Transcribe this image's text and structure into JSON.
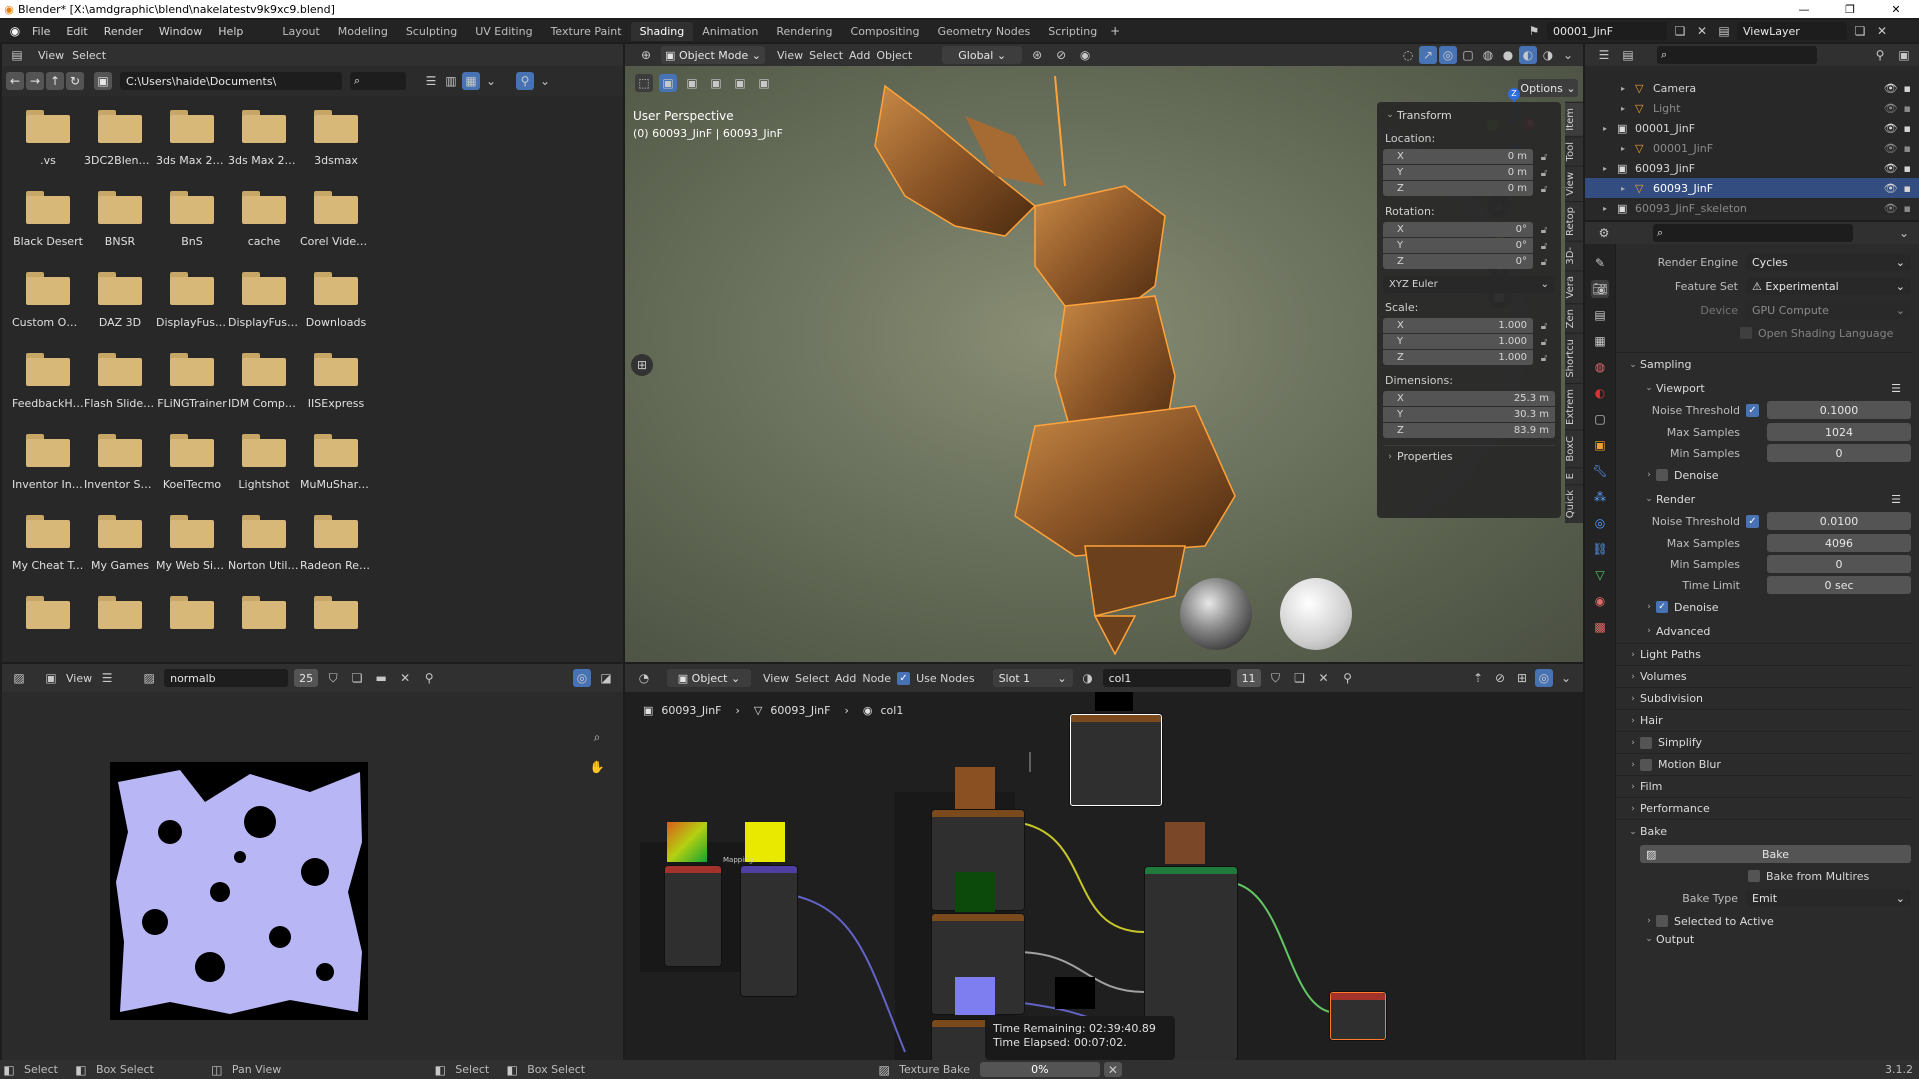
{
  "window": {
    "title": "Blender* [X:\\amdgraphic\\blend\\nakelatestv9k9xc9.blend]"
  },
  "menu": [
    "File",
    "Edit",
    "Render",
    "Window",
    "Help"
  ],
  "workspaces": [
    "Layout",
    "Modeling",
    "Sculpting",
    "UV Editing",
    "Texture Paint",
    "Shading",
    "Animation",
    "Rendering",
    "Compositing",
    "Geometry Nodes",
    "Scripting"
  ],
  "active_workspace": "Shading",
  "scene": "00001_JinF",
  "view_layer": "ViewLayer",
  "file_browser": {
    "menu": [
      "View",
      "Select"
    ],
    "path": "C:\\Users\\haide\\Documents\\",
    "folders": [
      ".vs",
      "3DC2Blender",
      "3ds Max 2020",
      "3ds Max 2023",
      "3dsmax",
      "Black Desert",
      "BNSR",
      "BnS",
      "cache",
      "Corel VideoSt...",
      "Custom Offic...",
      "DAZ 3D",
      "DisplayFusion...",
      "DisplayFusion...",
      "Downloads",
      "FeedbackHub",
      "Flash Slidesh...",
      "FLiNGTrainer",
      "IDM Compute...",
      "IISExpress",
      "Inventor Inter...",
      "Inventor Serv...",
      "KoeiTecmo",
      "Lightshot",
      "MuMuShared...",
      "My Cheat Tab...",
      "My Games",
      "My Web Sites",
      "Norton Utiliti...",
      "Radeon ReLive",
      "",
      "",
      "",
      "",
      "",
      ""
    ]
  },
  "viewport": {
    "mode": "Object Mode",
    "menu": [
      "View",
      "Select",
      "Add",
      "Object"
    ],
    "orientation": "Global",
    "options": "Options",
    "perspective": "User Perspective",
    "object_info": "(0) 60093_JinF | 60093_JinF",
    "transform": {
      "title": "Transform",
      "location_label": "Location:",
      "location": [
        [
          "X",
          "0 m"
        ],
        [
          "Y",
          "0 m"
        ],
        [
          "Z",
          "0 m"
        ]
      ],
      "rotation_label": "Rotation:",
      "rotation": [
        [
          "X",
          "0°"
        ],
        [
          "Y",
          "0°"
        ],
        [
          "Z",
          "0°"
        ]
      ],
      "rotation_mode": "XYZ Euler",
      "scale_label": "Scale:",
      "scale": [
        [
          "X",
          "1.000"
        ],
        [
          "Y",
          "1.000"
        ],
        [
          "Z",
          "1.000"
        ]
      ],
      "dimensions_label": "Dimensions:",
      "dimensions": [
        [
          "X",
          "25.3 m"
        ],
        [
          "Y",
          "30.3 m"
        ],
        [
          "Z",
          "83.9 m"
        ]
      ],
      "properties": "Properties"
    },
    "side_tabs": [
      "Item",
      "Tool",
      "View",
      "Retop",
      "3D-",
      "Vera",
      "Zen",
      "Shortcu",
      "Extrem",
      "BoxC",
      "E",
      "Quick"
    ]
  },
  "image_editor": {
    "menu": "View",
    "image": "normalb",
    "users": "25"
  },
  "node_editor": {
    "object": "Object",
    "menu": [
      "View",
      "Select",
      "Add",
      "Node"
    ],
    "use_nodes": "Use Nodes",
    "slot": "Slot 1",
    "material": "col1",
    "users": "11",
    "breadcrumb": [
      "60093_JinF",
      "60093_JinF",
      "col1"
    ],
    "mapping_label": "Mapping",
    "time_remaining": "Time Remaining: 02:39:40.89",
    "time_elapsed": "Time Elapsed: 00:07:02."
  },
  "outliner": {
    "items": [
      {
        "name": "Camera",
        "indent": 2,
        "dim": false,
        "selected": false
      },
      {
        "name": "Light",
        "indent": 2,
        "dim": true,
        "selected": false
      },
      {
        "name": "00001_JinF",
        "indent": 1,
        "dim": false,
        "selected": false
      },
      {
        "name": "00001_JinF",
        "indent": 2,
        "dim": true,
        "selected": false
      },
      {
        "name": "60093_JinF",
        "indent": 1,
        "dim": false,
        "selected": false
      },
      {
        "name": "60093_JinF",
        "indent": 2,
        "dim": false,
        "selected": true
      },
      {
        "name": "60093_JinF_skeleton",
        "indent": 1,
        "dim": true,
        "selected": false
      }
    ]
  },
  "properties": {
    "render_engine_label": "Render Engine",
    "render_engine": "Cycles",
    "feature_set_label": "Feature Set",
    "feature_set": "Experimental",
    "device_label": "Device",
    "device": "GPU Compute",
    "osl": "Open Shading Language",
    "sampling": "Sampling",
    "viewport": "Viewport",
    "noise_threshold": "Noise Threshold",
    "vp_noise": "0.1000",
    "max_samples": "Max Samples",
    "vp_max": "1024",
    "min_samples": "Min Samples",
    "vp_min": "0",
    "denoise": "Denoise",
    "render": "Render",
    "r_noise": "0.0100",
    "r_max": "4096",
    "r_min": "0",
    "time_limit": "Time Limit",
    "r_time": "0 sec",
    "advanced": "Advanced",
    "panels": [
      "Light Paths",
      "Volumes",
      "Subdivision",
      "Hair",
      "Simplify",
      "Motion Blur",
      "Film",
      "Performance"
    ],
    "bake": "Bake",
    "bake_button": "Bake",
    "bake_multires": "Bake from Multires",
    "bake_type_label": "Bake Type",
    "bake_type": "Emit",
    "selected_to_active": "Selected to Active",
    "output": "Output"
  },
  "status": {
    "items": [
      "Select",
      "Box Select",
      "Pan View",
      "Select",
      "Box Select"
    ],
    "job": "Texture Bake",
    "progress": "0%",
    "progress_value": 0,
    "version": "3.1.2"
  },
  "colors": {
    "accent": "#4772b3",
    "header": "#303030",
    "panel": "#282828",
    "selected": "#334d80",
    "folder": "#d8b878",
    "uv_fill": "#b9b6f5"
  }
}
